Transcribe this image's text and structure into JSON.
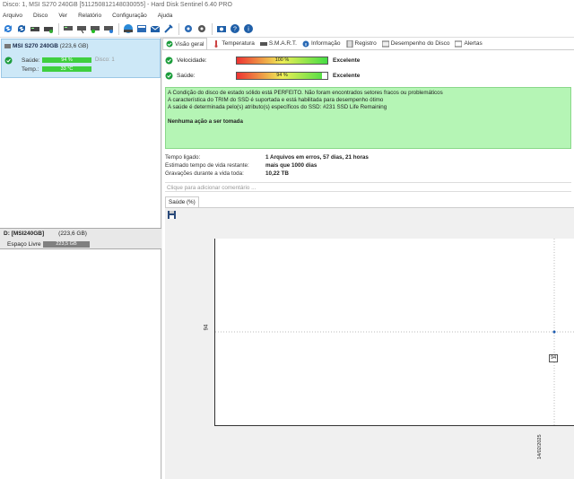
{
  "window": {
    "title": "Disco: 1, MSI S270 240GB [511250812148030055] - Hard Disk Sentinel 6.40 PRO"
  },
  "menu": [
    "Arquivo",
    "Disco",
    "Ver",
    "Relatório",
    "Configuração",
    "Ajuda"
  ],
  "disk": {
    "name": "MSI S270 240GB",
    "size": "(223,6 GB)",
    "health_label": "Saúde:",
    "health_value": "94 %",
    "temp_label": "Temp.:",
    "temp_value": "33 °C",
    "disco_label": "Disco: 1"
  },
  "volume": {
    "name": "D: [MSI240GB]",
    "size": "(223,6 GB)",
    "free_label": "Espaço Livre",
    "free_value": "223,5 GB"
  },
  "tabs": [
    "Visão geral",
    "Temperatura",
    "S.M.A.R.T.",
    "Informação",
    "Registro",
    "Desempenho do Disco",
    "Alertas"
  ],
  "metrics": {
    "speed_label": "Velocidade:",
    "speed_value": "100 %",
    "speed_fraction": 1.0,
    "speed_status": "Excelente",
    "health_label": "Saúde:",
    "health_value": "94 %",
    "health_fraction": 0.94,
    "health_status": "Excelente"
  },
  "status": {
    "line1": "A Condição do disco de estado sólido está PERFEITO. Não foram encontrados setores fracos ou problemáticos",
    "line2": "A característica do TRIM do SSD é suportada e está habilitada para desempenho ótimo",
    "line3": "A saúde é determinada pelo(s) atributo(s) específicos do SSD: #231 SSD Life Remaining",
    "action": "Nenhuma ação a ser tomada"
  },
  "info": {
    "powered_label": "Tempo ligado:",
    "powered_value": "1 Arquivos em erros, 57 dias, 21 horas",
    "remaining_label": "Estimado tempo de vida restante:",
    "remaining_value": "mais que 1000 dias",
    "writes_label": "Gravações durante a vida toda:",
    "writes_value": "10,22 TB"
  },
  "comment_placeholder": "Clique para adicionar comentário ...",
  "chart_tab": "Saúde (%)",
  "chart_data": {
    "type": "line",
    "x": [
      "14/02/2025"
    ],
    "series": [
      {
        "values": [
          94
        ]
      }
    ],
    "ytick": "94",
    "point_label": "94",
    "xtick": "14/02/2025"
  }
}
